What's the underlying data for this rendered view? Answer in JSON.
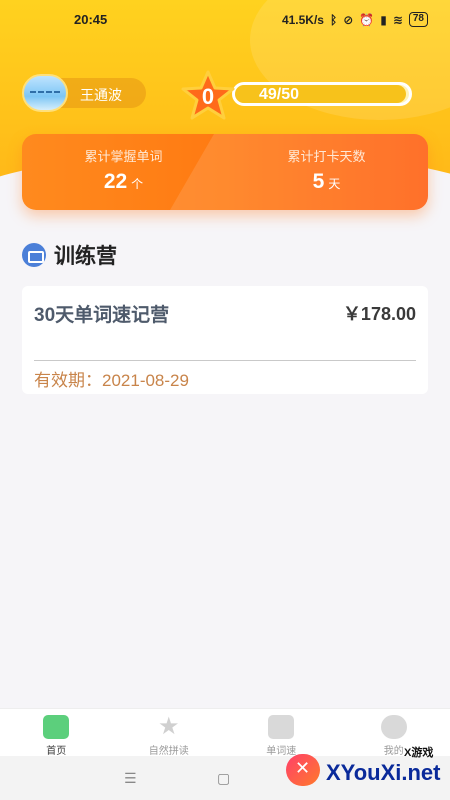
{
  "status_bar": {
    "time": "20:45",
    "network_speed": "41.5K/s",
    "battery": "78",
    "icons": [
      "bluetooth-icon",
      "mute-icon",
      "alarm-icon",
      "signal-icon",
      "wifi-icon",
      "battery-icon"
    ]
  },
  "user": {
    "name": "王通波"
  },
  "level": {
    "star_value": "0",
    "progress_text": "49/50",
    "progress_fraction": 0.98
  },
  "stats": {
    "words_label": "累计掌握单词",
    "words_value": "22",
    "words_unit": "个",
    "days_label": "累计打卡天数",
    "days_value": "5",
    "days_unit": "天"
  },
  "section": {
    "title": "训练营"
  },
  "course": {
    "name": "30天单词速记营",
    "price": "￥178.00",
    "expiry": "有效期：2021-08-29"
  },
  "tabs": [
    {
      "label": "首页",
      "active": true
    },
    {
      "label": "自然拼读",
      "active": false
    },
    {
      "label": "单词速",
      "active": false
    },
    {
      "label": "我的",
      "active": false
    }
  ],
  "watermark": {
    "small": "X游戏",
    "text": "XYouXi.net"
  },
  "colors": {
    "header": "#ffc21a",
    "stats_card": "#ff7a12",
    "active_tab": "#5ccf7c",
    "expiry": "#c8844a"
  }
}
